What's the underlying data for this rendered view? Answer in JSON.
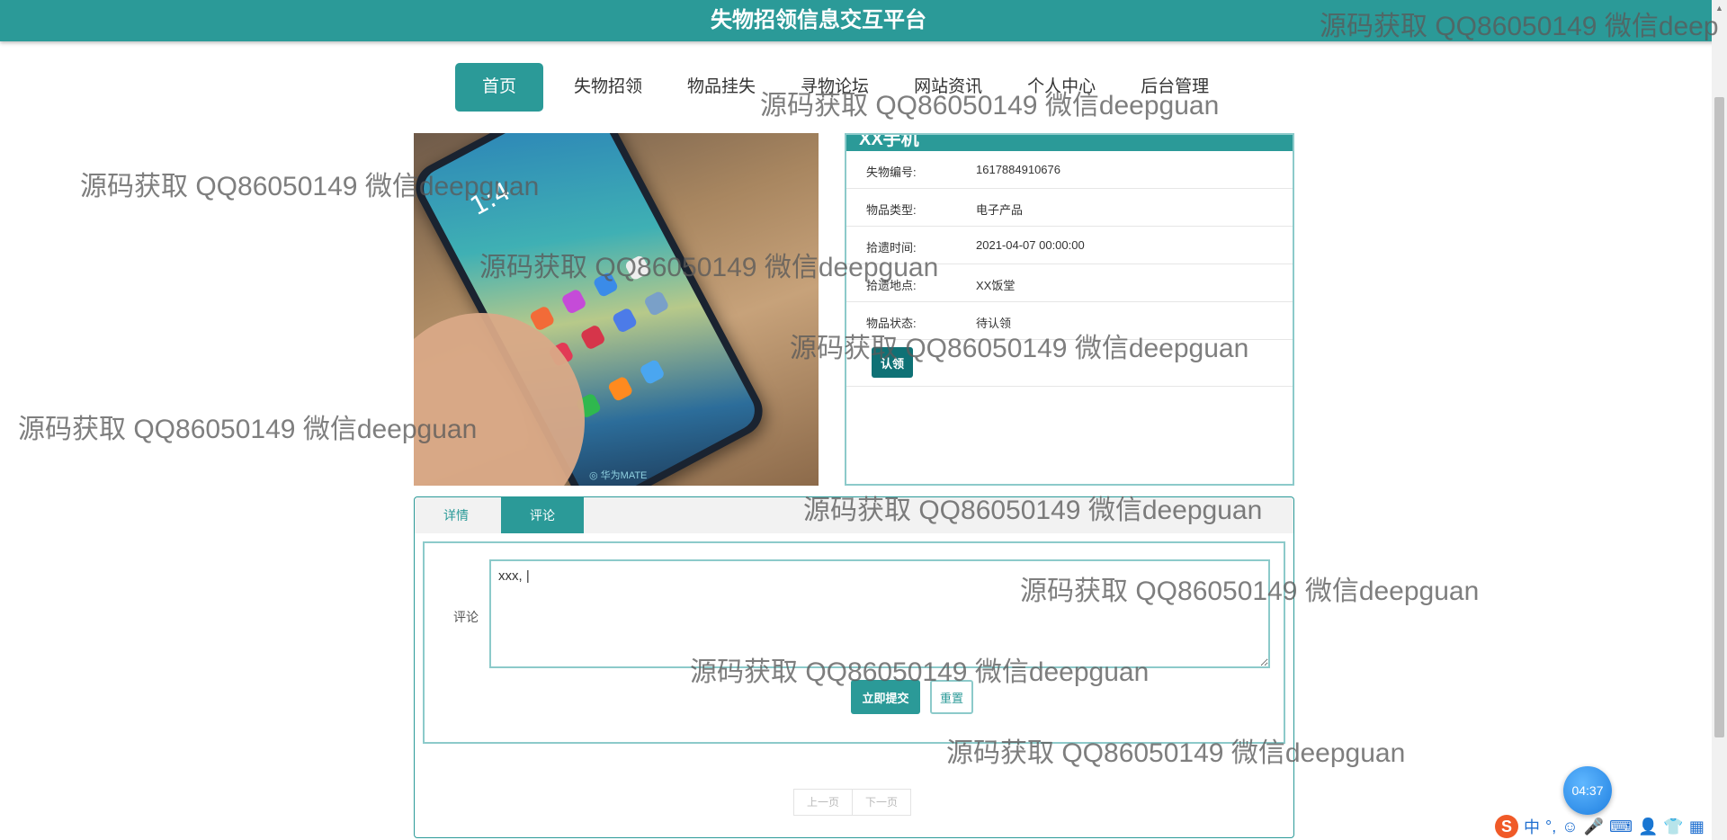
{
  "header": {
    "title": "失物招领信息交互平台"
  },
  "nav": {
    "items": [
      "首页",
      "失物招领",
      "物品挂失",
      "寻物论坛",
      "网站资讯",
      "个人中心",
      "后台管理"
    ]
  },
  "photo": {
    "clock": "1:4",
    "stamp": "◎ 华为MATE"
  },
  "item": {
    "name": "XX手机",
    "fields": [
      {
        "label": "失物编号:",
        "value": "1617884910676"
      },
      {
        "label": "物品类型:",
        "value": "电子产品"
      },
      {
        "label": "拾遗时间:",
        "value": "2021-04-07 00:00:00"
      },
      {
        "label": "拾遗地点:",
        "value": "XX饭堂"
      },
      {
        "label": "物品状态:",
        "value": "待认领"
      }
    ],
    "claim_label": "认领"
  },
  "tabs": {
    "details": "详情",
    "comments": "评论"
  },
  "comment_form": {
    "label": "评论",
    "value": "xxx, |",
    "submit": "立即提交",
    "reset": "重置"
  },
  "pager": {
    "prev": "上一页",
    "next": "下一页"
  },
  "clock_badge": "04:37",
  "ime": {
    "logo": "S",
    "symbols": [
      "中",
      "°,",
      "☺",
      "🎤",
      "⌨",
      "👤",
      "👕",
      "▦"
    ]
  },
  "watermarks": [
    "源码获取 QQ86050149 微信deep",
    "源码获取 QQ86050149 微信deepguan",
    "源码获取 QQ86050149 微信deepguan",
    "源码获取 QQ86050149 微信deepguan",
    "源码获取 QQ86050149 微信deepguan",
    "源码获取 QQ86050149 微信deepguan",
    "源码获取 QQ86050149 微信deepguan",
    "源码获取 QQ86050149 微信deepguan",
    "源码获取 QQ86050149 微信deepguan",
    "源码获取 QQ86050149 微信deepguan"
  ]
}
